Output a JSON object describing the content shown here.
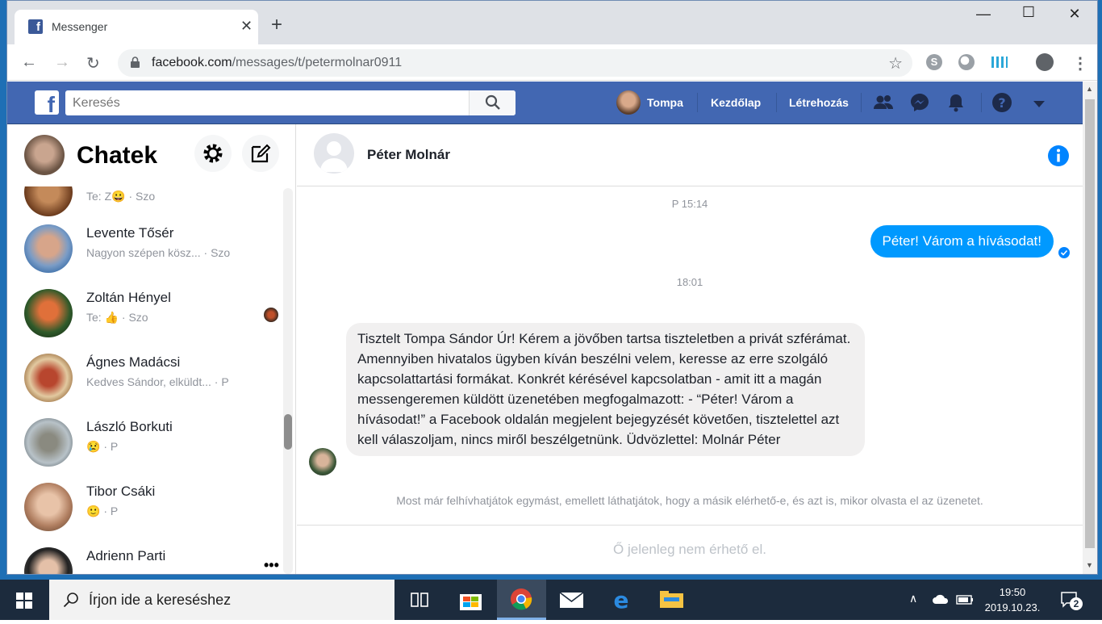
{
  "browser": {
    "tab_title": "Messenger",
    "url_domain": "facebook.com",
    "url_path": "/messages/t/petermolnar0911"
  },
  "facebook": {
    "search_placeholder": "Keresés",
    "profile_name": "Tompa",
    "nav_home": "Kezdőlap",
    "nav_create": "Létrehozás"
  },
  "sidebar": {
    "title": "Chatek",
    "conversations": [
      {
        "name": "",
        "preview": "Te: Z😀",
        "time": "· Szo"
      },
      {
        "name": "Levente Tősér",
        "preview": "Nagyon szépen kösz...",
        "time": "· Szo"
      },
      {
        "name": "Zoltán Hényel",
        "preview": "Te: 👍",
        "time": "· Szo"
      },
      {
        "name": "Ágnes Madácsi",
        "preview": "Kedves Sándor, elküldt...",
        "time": "· P"
      },
      {
        "name": "László Borkuti",
        "preview": "😢",
        "time": "· P"
      },
      {
        "name": "Tibor Csáki",
        "preview": "🙂",
        "time": "· P"
      },
      {
        "name": "Adrienn Parti",
        "preview": "",
        "time": ""
      }
    ]
  },
  "conversation": {
    "contact_name": "Péter Molnár",
    "timestamp_1": "P 15:14",
    "outgoing_message": "Péter! Várom a hívásodat!",
    "timestamp_2": "18:01",
    "incoming_message": "Tisztelt Tompa Sándor Úr! Kérem a jövőben tartsa tiszteletben a privát szférámat. Amennyiben hivatalos ügyben kíván beszélni velem, keresse az erre szolgáló kapcsolattartási formákat. Konkrét kérésével kapcsolatban - amit itt a magán messengeremen küldött üzenetében megfogalmazott: - “Péter! Várom a hívásodat!” a Facebook oldalán megjelent bejegyzését követően, tisztelettel azt kell válaszoljam, nincs miről beszélgetnünk. Üdvözlettel: Molnár Péter",
    "call_note": "Most már felhívhatjátok egymást, emellett láthatjátok, hogy a másik elérhető-e, és azt is, mikor olvasta el az üzenetet.",
    "composer_placeholder": "Ő jelenleg nem érhető el."
  },
  "taskbar": {
    "search_placeholder": "Írjon ide a kereséshez",
    "time": "19:50",
    "date": "2019.10.23.",
    "notification_count": "2"
  },
  "colors": {
    "facebook_blue": "#4267b2",
    "messenger_blue": "#0099ff",
    "taskbar": "#1c2b3d"
  }
}
